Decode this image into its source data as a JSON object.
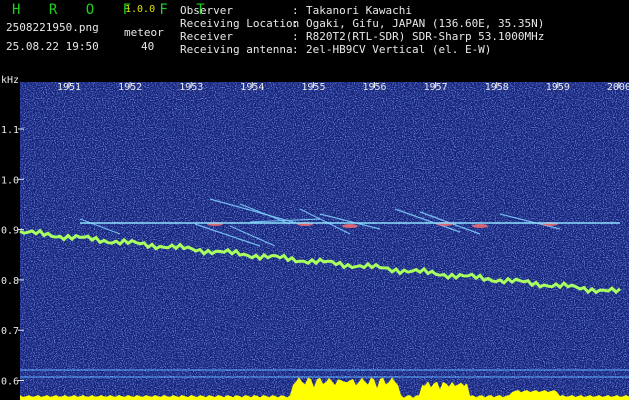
{
  "header": {
    "app_title": "H R O F F T",
    "app_version": "1.0.0",
    "file_name": "2508221950.png",
    "meteor_label": "meteor",
    "meteor_count": "40",
    "datetime": "25.08.22 19:50",
    "info": [
      {
        "key": "Observer",
        "value": "Takanori Kawachi"
      },
      {
        "key": "Receiving Location",
        "value": "Ogaki, Gifu, JAPAN (136.60E, 35.35N)"
      },
      {
        "key": "Receiver",
        "value": "R820T2(RTL-SDR) SDR-Sharp 53.1000MHz"
      },
      {
        "key": "Receiving antenna",
        "value": "2el-HB9CV Vertical (el. E-W)"
      }
    ],
    "separator": ":"
  },
  "spectrogram": {
    "y_unit": "kHz",
    "time_ticks": [
      "1951",
      "1952",
      "1953",
      "1954",
      "1955",
      "1956",
      "1957",
      "1958",
      "1959",
      "2000"
    ],
    "freq_ticks": [
      "1.1",
      "1.0",
      "0.9",
      "0.8",
      "0.7",
      "0.6"
    ],
    "colors": {
      "background": "#16237a",
      "carrier": "#8fe0ff",
      "trace": "#a8ff60",
      "power": "#ffff00",
      "marker": "#5fb0ff"
    }
  }
}
